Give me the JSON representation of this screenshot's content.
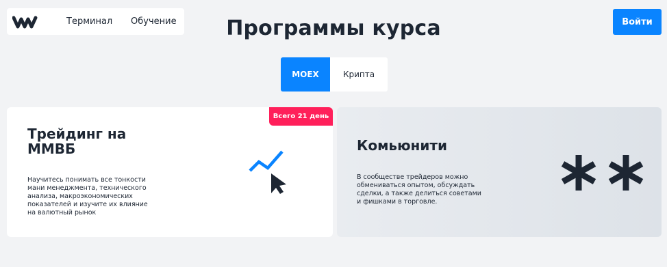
{
  "nav": {
    "logo_icon": "wave-logo-icon",
    "links": [
      "Терминал",
      "Обучение"
    ],
    "login_label": "Войти"
  },
  "page_title": "Программы курса",
  "tabs": [
    {
      "label": "MOEX",
      "active": true
    },
    {
      "label": "Крипта",
      "active": false
    }
  ],
  "cards": [
    {
      "title": "Трейдинг на ММВБ",
      "description": "Научитесь понимать все тонкости мани менеджмента, технического анализа, макроэкономических показателей и изучите их влияние на валютный рынок",
      "badge": "Всего 21 день",
      "icon": "chart-cursor-icon"
    },
    {
      "title": "Комьюнити",
      "description": "В сообществе трейдеров можно обмениваться опытом, обсуждать сделки, а также делиться советами и фишками в торговле.",
      "icon": "asterisks-icon"
    }
  ],
  "colors": {
    "accent": "#0a84ff",
    "badge": "#ff1f5a",
    "background": "#f2f3f5",
    "text": "#1d2633"
  }
}
